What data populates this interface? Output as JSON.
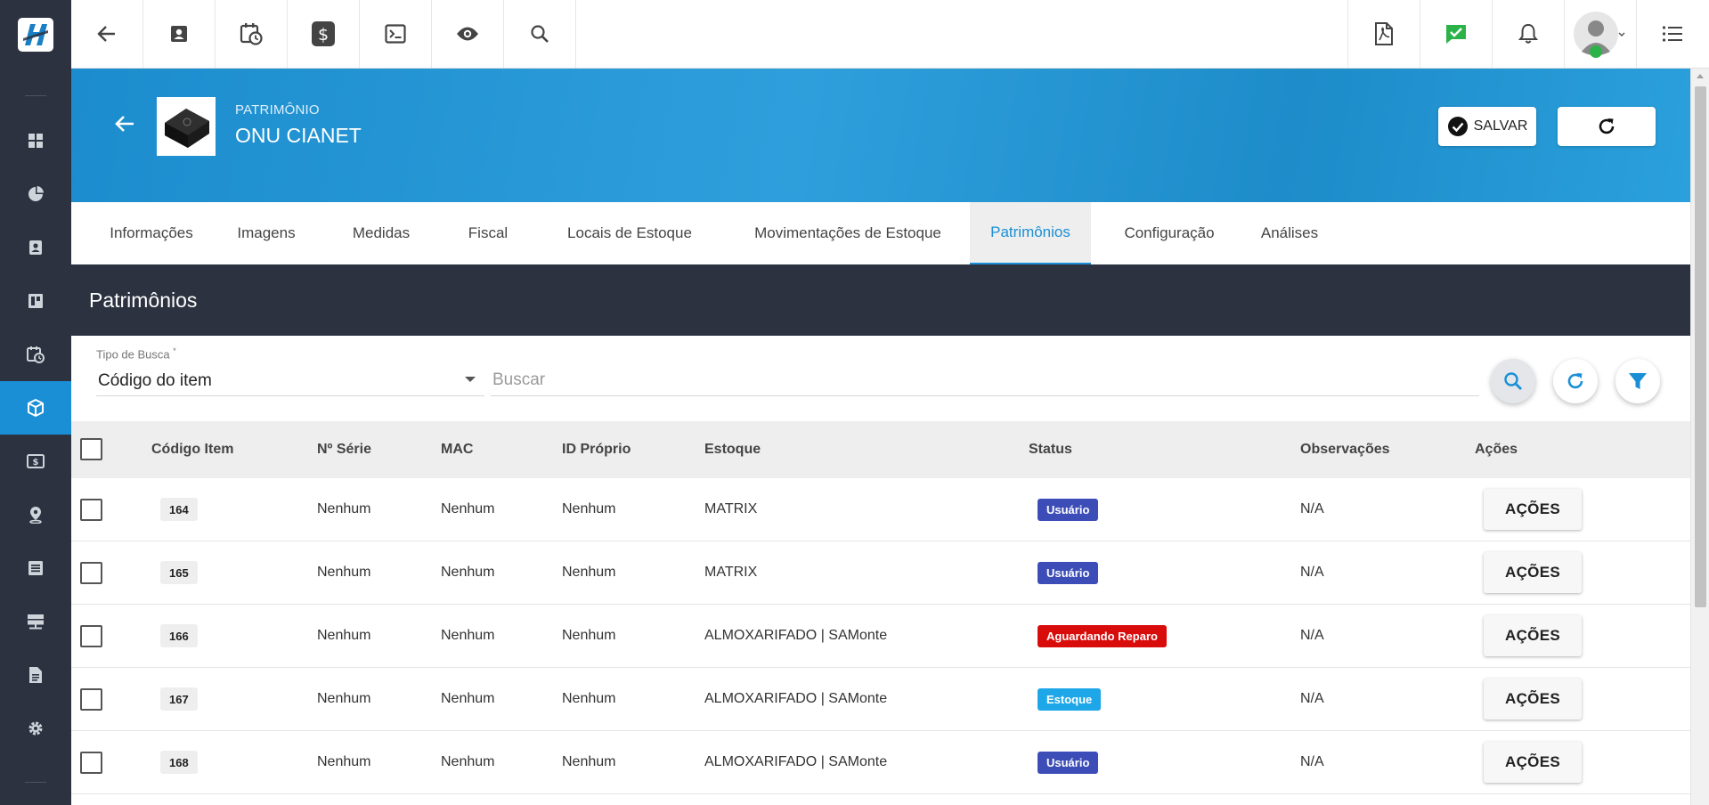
{
  "topbar": {
    "left_icons": [
      "back-arrow-icon",
      "contact-card-icon",
      "calendar-clock-icon",
      "dollar-icon",
      "terminal-icon",
      "eye-icon",
      "search-icon"
    ],
    "right_icons": [
      "pdf-icon",
      "chat-check-icon",
      "bell-icon",
      "avatar",
      "list-icon"
    ],
    "status_color": "#2bb34a"
  },
  "sidebar": {
    "items": [
      {
        "icon": "dashboard-icon"
      },
      {
        "icon": "pie-chart-icon"
      },
      {
        "icon": "contact-card-icon"
      },
      {
        "icon": "kanban-icon"
      },
      {
        "icon": "calendar-clock-icon"
      },
      {
        "icon": "box-icon",
        "active": true
      },
      {
        "icon": "money-icon"
      },
      {
        "icon": "map-pin-icon"
      },
      {
        "icon": "list-box-icon"
      },
      {
        "icon": "server-icon"
      },
      {
        "icon": "document-icon"
      },
      {
        "icon": "gear-icon"
      }
    ]
  },
  "header": {
    "kicker": "PATRIMÔNIO",
    "title": "ONU CIANET",
    "save_label": "SALVAR"
  },
  "tabs": [
    {
      "label": "Informações"
    },
    {
      "label": "Imagens"
    },
    {
      "label": "Medidas"
    },
    {
      "label": "Fiscal"
    },
    {
      "label": "Locais de Estoque"
    },
    {
      "label": "Movimentações de Estoque"
    },
    {
      "label": "Patrimônios",
      "active": true
    },
    {
      "label": "Configuração"
    },
    {
      "label": "Análises"
    }
  ],
  "section": {
    "title": "Patrimônios"
  },
  "search": {
    "type_label": "Tipo de Busca",
    "required_mark": "*",
    "type_value": "Código do item",
    "placeholder": "Buscar"
  },
  "table": {
    "columns": [
      "Código Item",
      "Nº Série",
      "MAC",
      "ID Próprio",
      "Estoque",
      "Status",
      "Observações",
      "Ações"
    ],
    "action_label": "AÇÕES",
    "rows": [
      {
        "code": "164",
        "serial": "Nenhum",
        "mac": "Nenhum",
        "own_id": "Nenhum",
        "stock": "MATRIX",
        "status": "Usuário",
        "status_color": "#3d4db7",
        "notes": "N/A"
      },
      {
        "code": "165",
        "serial": "Nenhum",
        "mac": "Nenhum",
        "own_id": "Nenhum",
        "stock": "MATRIX",
        "status": "Usuário",
        "status_color": "#3d4db7",
        "notes": "N/A"
      },
      {
        "code": "166",
        "serial": "Nenhum",
        "mac": "Nenhum",
        "own_id": "Nenhum",
        "stock": "ALMOXARIFADO | SAMonte",
        "status": "Aguardando Reparo",
        "status_color": "#d90c0c",
        "notes": "N/A"
      },
      {
        "code": "167",
        "serial": "Nenhum",
        "mac": "Nenhum",
        "own_id": "Nenhum",
        "stock": "ALMOXARIFADO | SAMonte",
        "status": "Estoque",
        "status_color": "#1ea7e8",
        "notes": "N/A"
      },
      {
        "code": "168",
        "serial": "Nenhum",
        "mac": "Nenhum",
        "own_id": "Nenhum",
        "stock": "ALMOXARIFADO | SAMonte",
        "status": "Usuário",
        "status_color": "#3d4db7",
        "notes": "N/A"
      }
    ]
  },
  "colors": {
    "sidebar_bg": "#2c3240",
    "accent": "#1a8fd6",
    "header_blue": "#2a9ad8"
  }
}
